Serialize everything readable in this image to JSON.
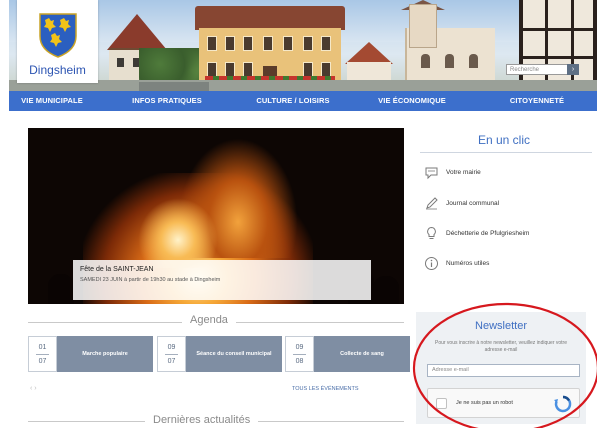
{
  "header": {
    "site_name": "Dingsheim",
    "search_placeholder": "Recherche",
    "search_button": "›",
    "icons": {
      "crest": "coat-of-arms-icon",
      "search": "search-icon"
    }
  },
  "nav": {
    "items": [
      {
        "label": "VIE MUNICIPALE"
      },
      {
        "label": "INFOS PRATIQUES"
      },
      {
        "label": "CULTURE / LOISIRS"
      },
      {
        "label": "VIE ÉCONOMIQUE"
      },
      {
        "label": "CITOYENNETÉ"
      }
    ],
    "color": "#3c6fcc"
  },
  "hero": {
    "title": "Fête de la SAINT-JEAN",
    "text": "SAMEDI 23 JUIN à partir de 19h30 au stade à Dingsheim"
  },
  "en_un_clic": {
    "title": "En un clic",
    "items": [
      {
        "label": "Votre mairie",
        "icon": "chat-bubble-icon"
      },
      {
        "label": "Journal communal",
        "icon": "pen-icon"
      },
      {
        "label": "Déchetterie de Pfulgriesheim",
        "icon": "lightbulb-icon"
      },
      {
        "label": "Numéros utiles",
        "icon": "info-icon"
      }
    ]
  },
  "agenda": {
    "title": "Agenda",
    "events": [
      {
        "day": "01",
        "month": "07",
        "title": "Marche populaire"
      },
      {
        "day": "09",
        "month": "07",
        "title": "Séance du conseil municipal"
      },
      {
        "day": "09",
        "month": "08",
        "title": "Collecte de sang"
      }
    ],
    "all_events": "TOUS LES ÉVÉNEMENTS",
    "prev": "‹ ›"
  },
  "newsletter": {
    "title": "Newsletter",
    "text": "Pour vous inscrire à notre newsletter, veuillez indiquer votre adresse e-mail",
    "input_placeholder": "Adresse e-mail",
    "captcha_label": "Je ne suis pas un robot"
  },
  "news": {
    "title": "Dernières actualités"
  },
  "colors": {
    "accent": "#3c6fcc",
    "title_blue": "#3f6fc2",
    "event_title_bg": "#7f8ea3",
    "annotation": "#d6181e"
  }
}
